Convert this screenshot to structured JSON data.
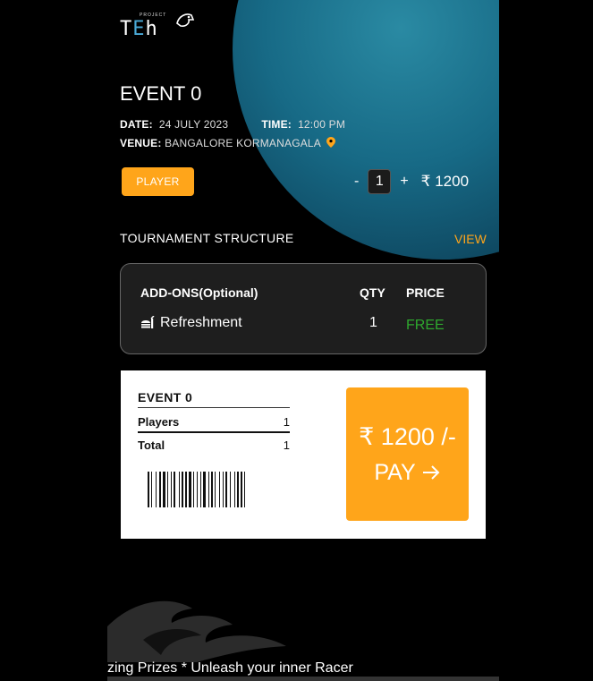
{
  "logo": {
    "project": "PROJECT",
    "word_part1": "T",
    "word_part2": "E",
    "word_part3": "h"
  },
  "event": {
    "title": "EVENT 0",
    "date_label": "DATE:",
    "date_value": "24 JULY 2023",
    "time_label": "TIME:",
    "time_value": "12:00 PM",
    "venue_label": "VENUE:",
    "venue_value": "BANGALORE KORMANAGALA"
  },
  "ticket_type": {
    "label": "PLAYER"
  },
  "stepper": {
    "minus": "-",
    "qty": "1",
    "plus": "+",
    "price": "₹ 1200"
  },
  "tournament": {
    "label": "TOURNAMENT STRUCTURE",
    "view": "VIEW"
  },
  "addons": {
    "title": "ADD-ONS(Optional)",
    "qty_header": "QTY",
    "price_header": "PRICE",
    "items": [
      {
        "name": "Refreshment",
        "qty": "1",
        "price": "FREE"
      }
    ]
  },
  "summary": {
    "title": "EVENT 0",
    "players_label": "Players",
    "players_value": "1",
    "total_label": "Total",
    "total_value": "1"
  },
  "pay": {
    "amount": "₹ 1200 /-",
    "label": "PAY"
  },
  "marquee": {
    "text": "zing Prizes * Unleash your inner Racer"
  },
  "colors": {
    "accent": "#ffa51a",
    "free": "#2ea82e",
    "planet": "#176a86"
  }
}
